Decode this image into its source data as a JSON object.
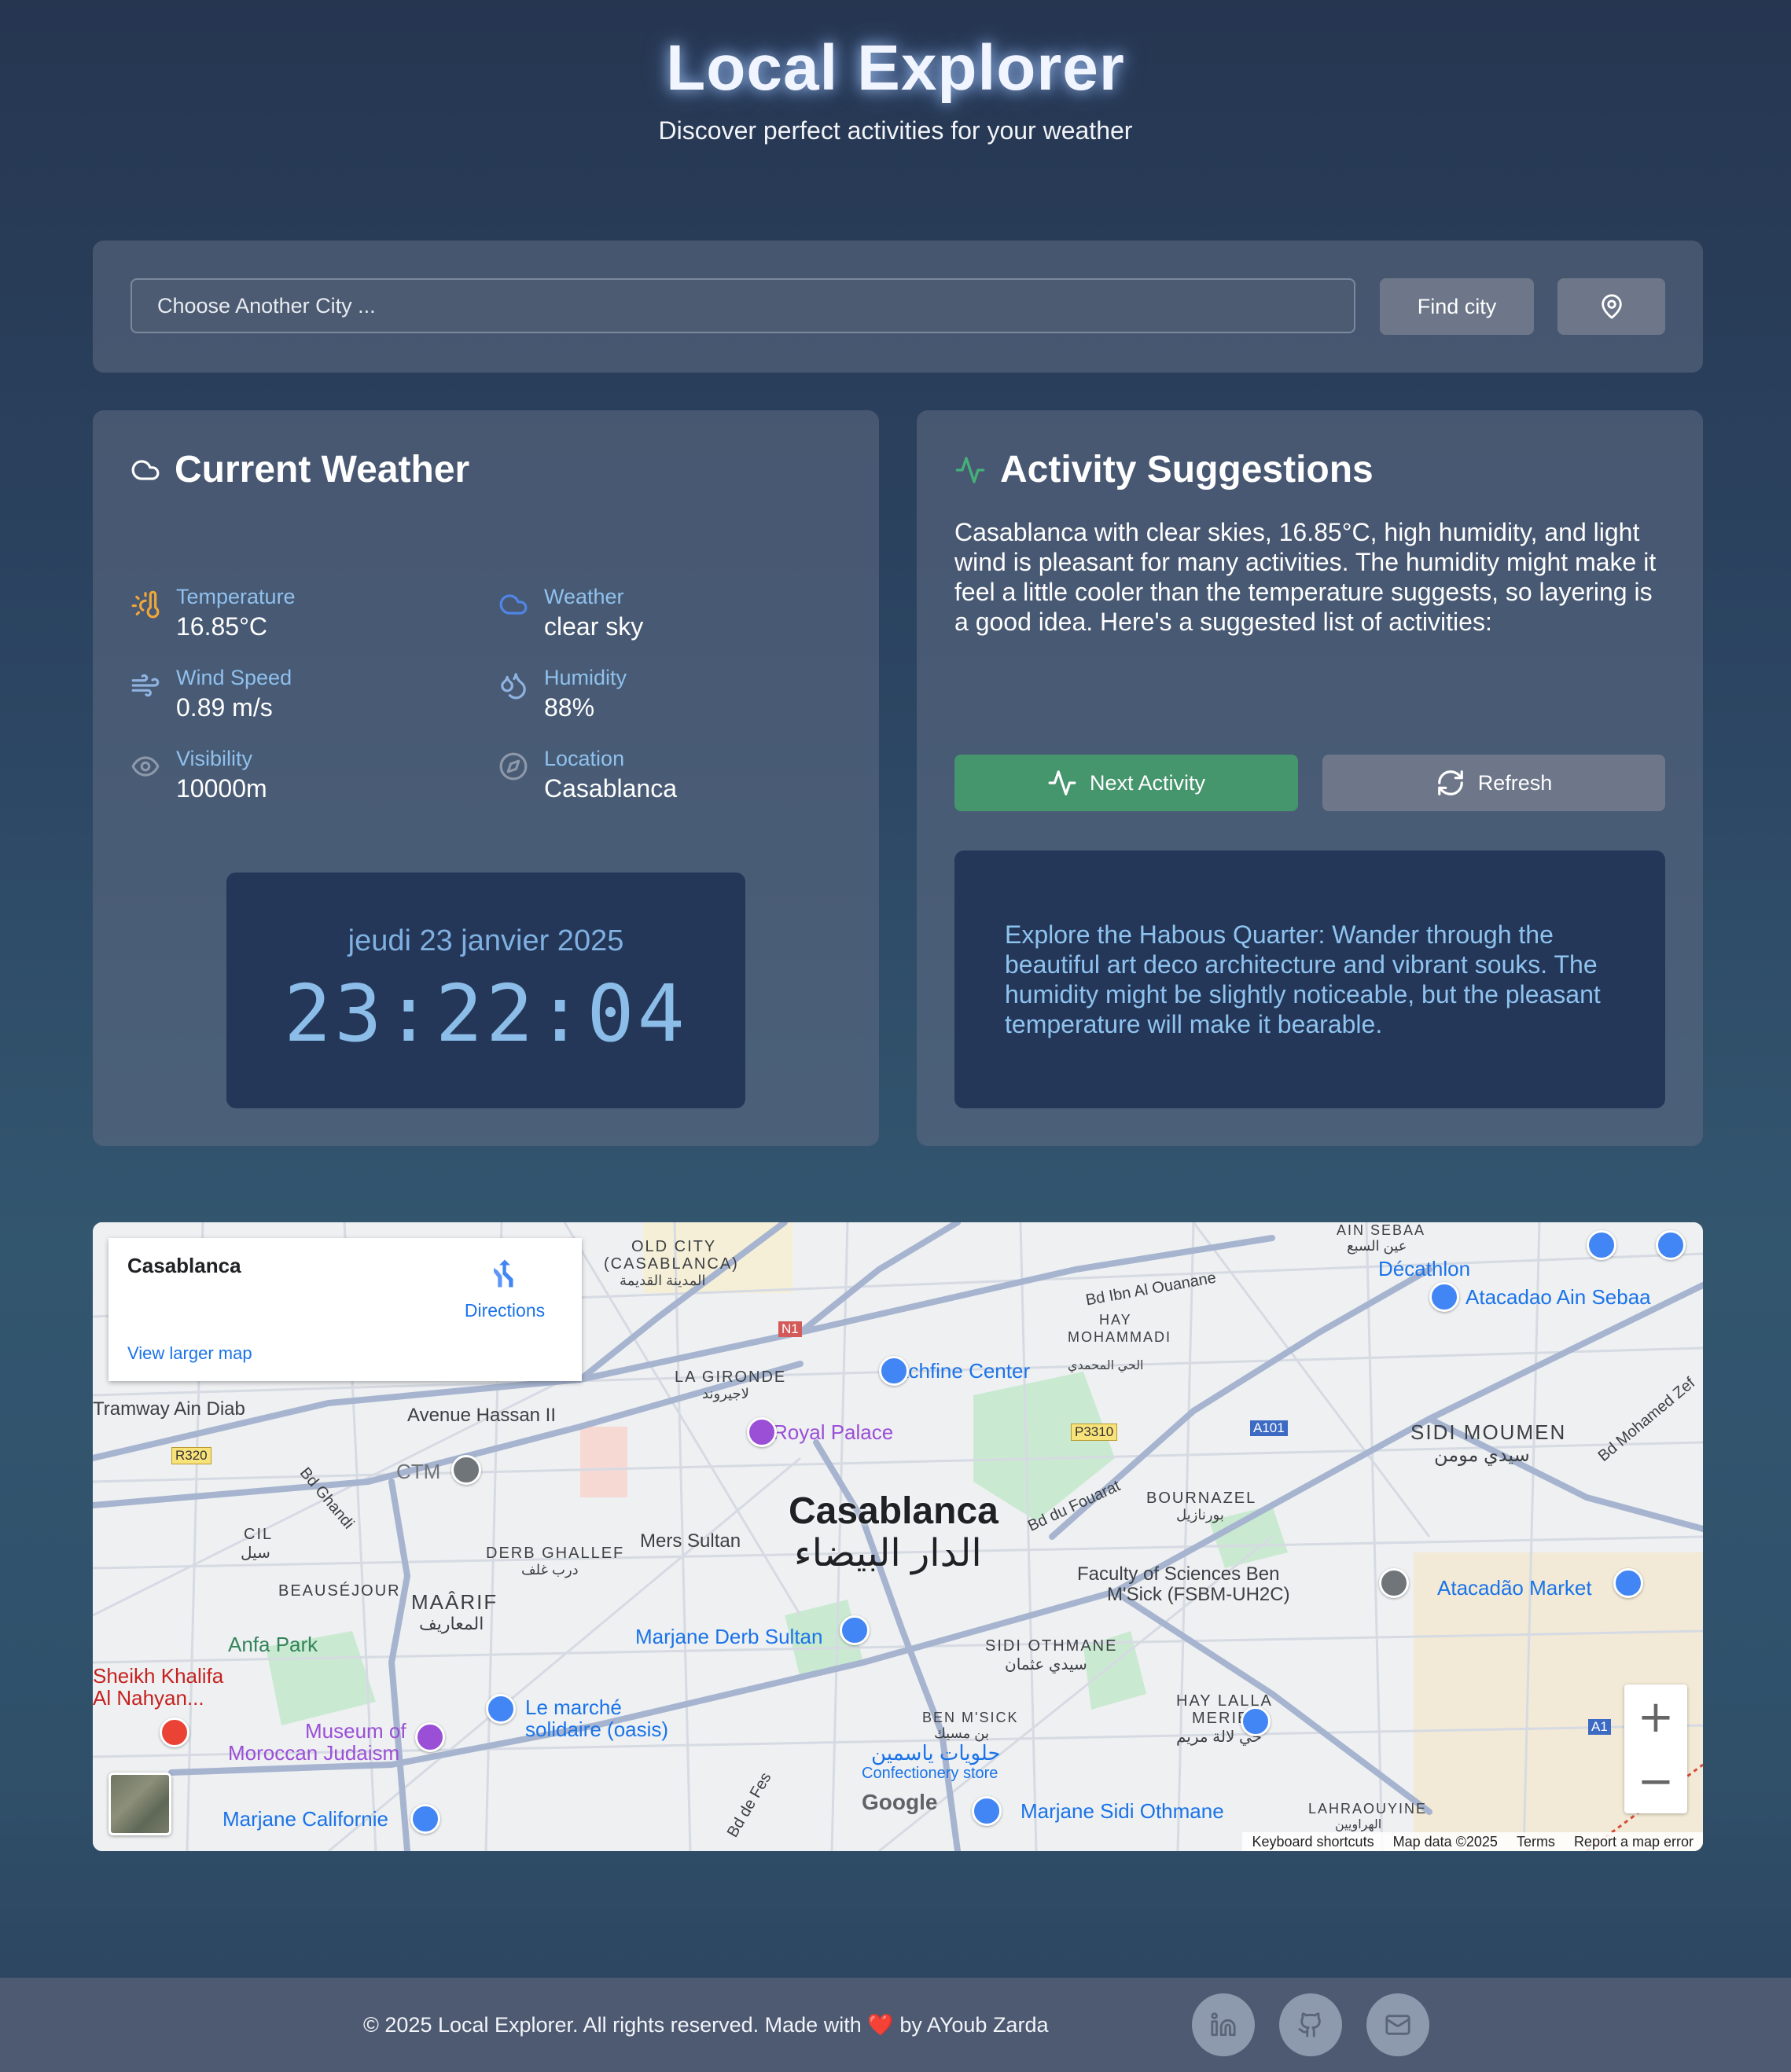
{
  "header": {
    "title": "Local Explorer",
    "subtitle": "Discover perfect activities for your weather"
  },
  "search": {
    "placeholder": "Choose Another City ...",
    "find_label": "Find city",
    "location_icon": "map-pin-icon"
  },
  "weather": {
    "title": "Current Weather",
    "stats": [
      {
        "label": "Temperature",
        "value": "16.85°C",
        "icon": "thermometer-sun-icon",
        "color": "#f0a73a"
      },
      {
        "label": "Weather",
        "value": "clear sky",
        "icon": "cloud-icon",
        "color": "#4f86e8"
      },
      {
        "label": "Wind Speed",
        "value": "0.89 m/s",
        "icon": "wind-icon",
        "color": "#8fb3e0"
      },
      {
        "label": "Humidity",
        "value": "88%",
        "icon": "droplets-icon",
        "color": "#8fb3e0"
      },
      {
        "label": "Visibility",
        "value": "10000m",
        "icon": "eye-icon",
        "color": "#8e98a8"
      },
      {
        "label": "Location",
        "value": "Casablanca",
        "icon": "compass-icon",
        "color": "#8e98a8"
      }
    ],
    "date": "jeudi 23 janvier 2025",
    "time": "23:22:04"
  },
  "activity": {
    "title": "Activity Suggestions",
    "intro": "Casablanca with clear skies, 16.85°C, high humidity, and light wind is pleasant for many activities. The humidity might make it feel a little cooler than the temperature suggests, so layering is a good idea. Here's a suggested list of activities:",
    "next_label": "Next Activity",
    "refresh_label": "Refresh",
    "suggestion": "Explore the Habous Quarter: Wander through the beautiful art deco architecture and vibrant souks. The humidity might be slightly noticeable, but the pleasant temperature will make it bearable."
  },
  "map": {
    "place": "Casablanca",
    "directions": "Directions",
    "view_larger": "View larger map",
    "city_label": "Casablanca",
    "city_label_ar": "الدار البيضاء",
    "labels": [
      "OLD CITY",
      "(CASABLANCA)",
      "المدينة القديمة",
      "LA GIRONDE",
      "لاجيروند",
      "Tachfine Center",
      "Royal Palace",
      "Avenue Hassan II",
      "CTM",
      "Mers Sultan",
      "DERB GHALLEF",
      "درب غلف",
      "MAÂRIF",
      "المعاريف",
      "BEAUSÉJOUR",
      "Anfa Park",
      "Marjane Derb Sultan",
      "Le marché",
      "solidaire (oasis)",
      "Museum of",
      "Moroccan Judaism",
      "Marjane Californie",
      "BEN M'SICK",
      "بن مسيك",
      "حلويات ياسمين",
      "Confectionery store",
      "Marjane Sidi Othmane",
      "SIDI OTHMANE",
      "سيدي عثمان",
      "HAY LALLA",
      "MERIEM",
      "حي لالة مريم",
      "Faculty of Sciences Ben",
      "M'Sick (FSBM-UH2C)",
      "Atacadão Market",
      "BOURNAZEL",
      "بورنازيل",
      "Bd du Fouarat",
      "HAY",
      "MOHAMMADI",
      "الحي المحمدي",
      "Bd Ibn Al Ouanane",
      "Décathlon",
      "Atacadao Ain Sebaa",
      "SIDI MOUMEN",
      "سيدي مومن",
      "Bd Mohamed Zef",
      "AIN SEBAA",
      "عين السبع",
      "Tramway Ain Diab",
      "CIL",
      "سيل",
      "Bd Ghandi",
      "Sheikh Khalifa",
      "Al Nahyan...",
      "Bd de Fes",
      "LAHRAOUYINE",
      "الهراويين",
      "R320",
      "N1",
      "P3310",
      "A101",
      "A1"
    ],
    "attribution": [
      "Keyboard shortcuts",
      "Map data ©2025",
      "Terms",
      "Report a map error"
    ],
    "google": "Google",
    "colors": {
      "pin_blue": "#4285f4",
      "pin_purple": "#9a4fd6",
      "pin_red": "#ea4335",
      "road": "#a6b4cf",
      "park": "#c9ead0"
    }
  },
  "footer": {
    "copyright": "© 2025 Local Explorer. All rights reserved. Made with ❤️ by AYoub Zarda",
    "social": [
      "linkedin-icon",
      "github-icon",
      "mail-icon"
    ]
  }
}
